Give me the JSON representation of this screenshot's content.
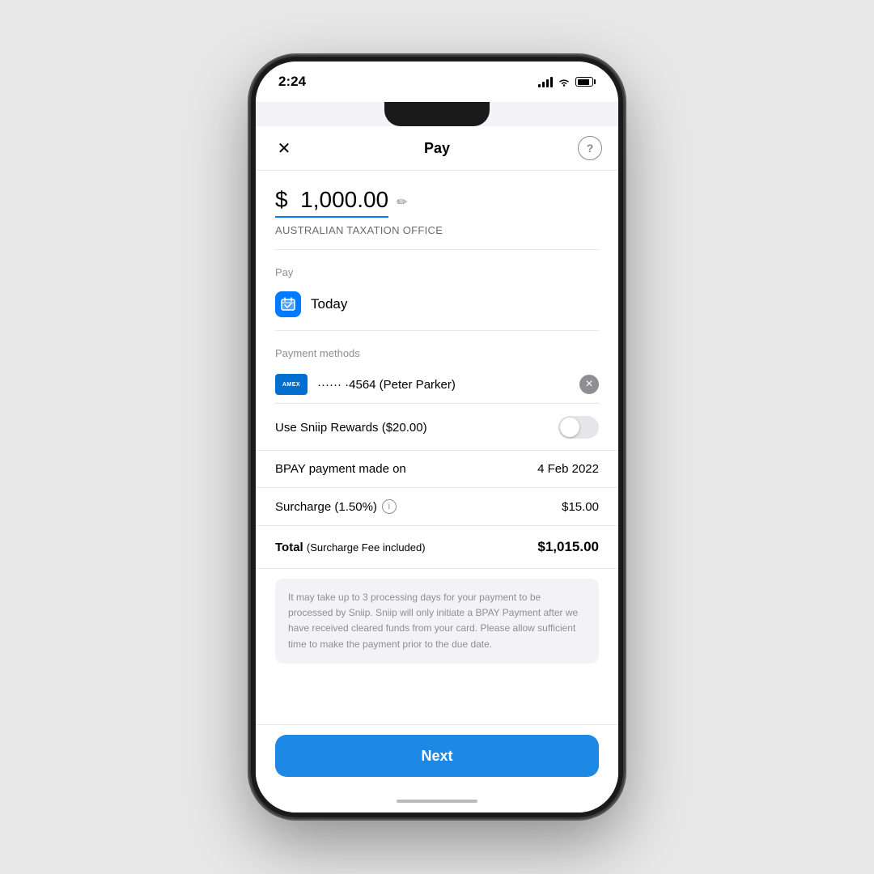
{
  "status_bar": {
    "time": "2:24",
    "icons": {
      "signal": "signal-icon",
      "wifi": "wifi-icon",
      "battery": "battery-icon"
    }
  },
  "nav": {
    "title": "Pay",
    "close_label": "×",
    "help_label": "?"
  },
  "amount": {
    "currency_symbol": "$",
    "value": "1,000.00",
    "biller_name": "AUSTRALIAN TAXATION OFFICE"
  },
  "pay_section": {
    "label": "Pay",
    "date_label": "Today"
  },
  "payment_methods": {
    "label": "Payment methods",
    "card_dots": "······",
    "card_number": "4564",
    "card_holder": "Peter Parker",
    "card_display": "······ ·4564 (Peter Parker)"
  },
  "rewards": {
    "label": "Use Sniip Rewards ($20.00)",
    "enabled": false
  },
  "bpay": {
    "label": "BPAY payment made on",
    "date": "4 Feb 2022"
  },
  "surcharge": {
    "label": "Surcharge (1.50%)",
    "value": "$15.00"
  },
  "total": {
    "label": "Total",
    "sub_label": "(Surcharge Fee included)",
    "value": "$1,015.00"
  },
  "disclaimer": {
    "text": "It may take up to 3 processing days for your payment to be processed by Sniip. Sniip will only initiate a BPAY Payment after we have received cleared funds from your card. Please allow sufficient time to make the payment prior to the due date."
  },
  "next_button": {
    "label": "Next"
  }
}
